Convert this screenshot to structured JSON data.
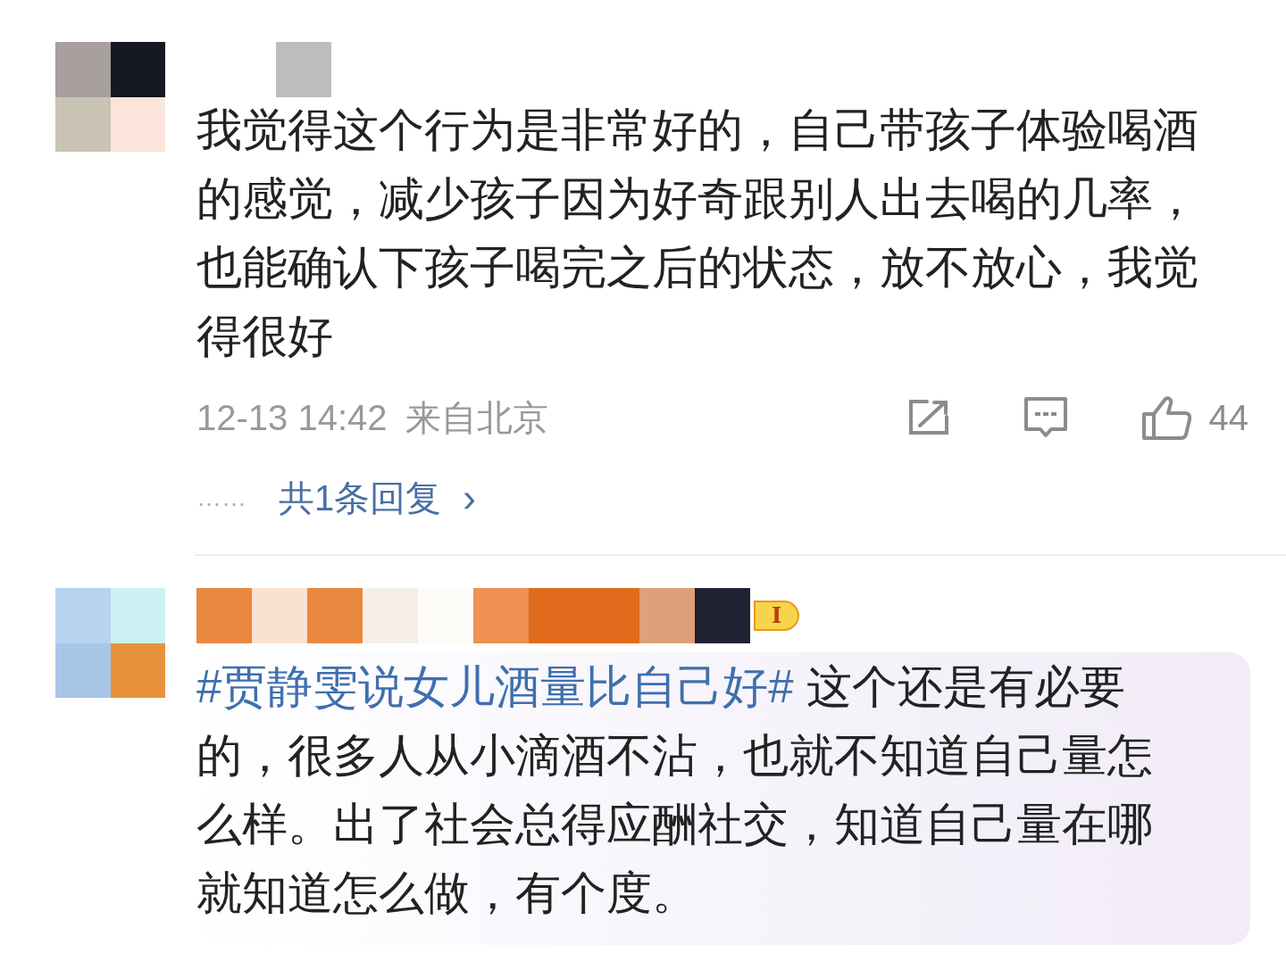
{
  "comments": [
    {
      "text": "我觉得这个行为是非常好的，自己带孩子体验喝酒的感觉，减少孩子因为好奇跟别人出去喝的几率，也能确认下孩子喝完之后的状态，放不放心，我觉得很好",
      "time": "12-13 14:42",
      "location": "来自北京",
      "likes": "44",
      "replies": {
        "dots": "……",
        "label": "共1条回复",
        "chevron": "›"
      },
      "card": false
    },
    {
      "level_badge": "I",
      "hashtag": "#贾静雯说女儿酒量比自己好#",
      "text": " 这个还是有必要的，很多人从小滴酒不沾，也就不知道自己量怎么样。出了社会总得应酬社交，知道自己量在哪就知道怎么做，有个度。",
      "card": true
    }
  ]
}
